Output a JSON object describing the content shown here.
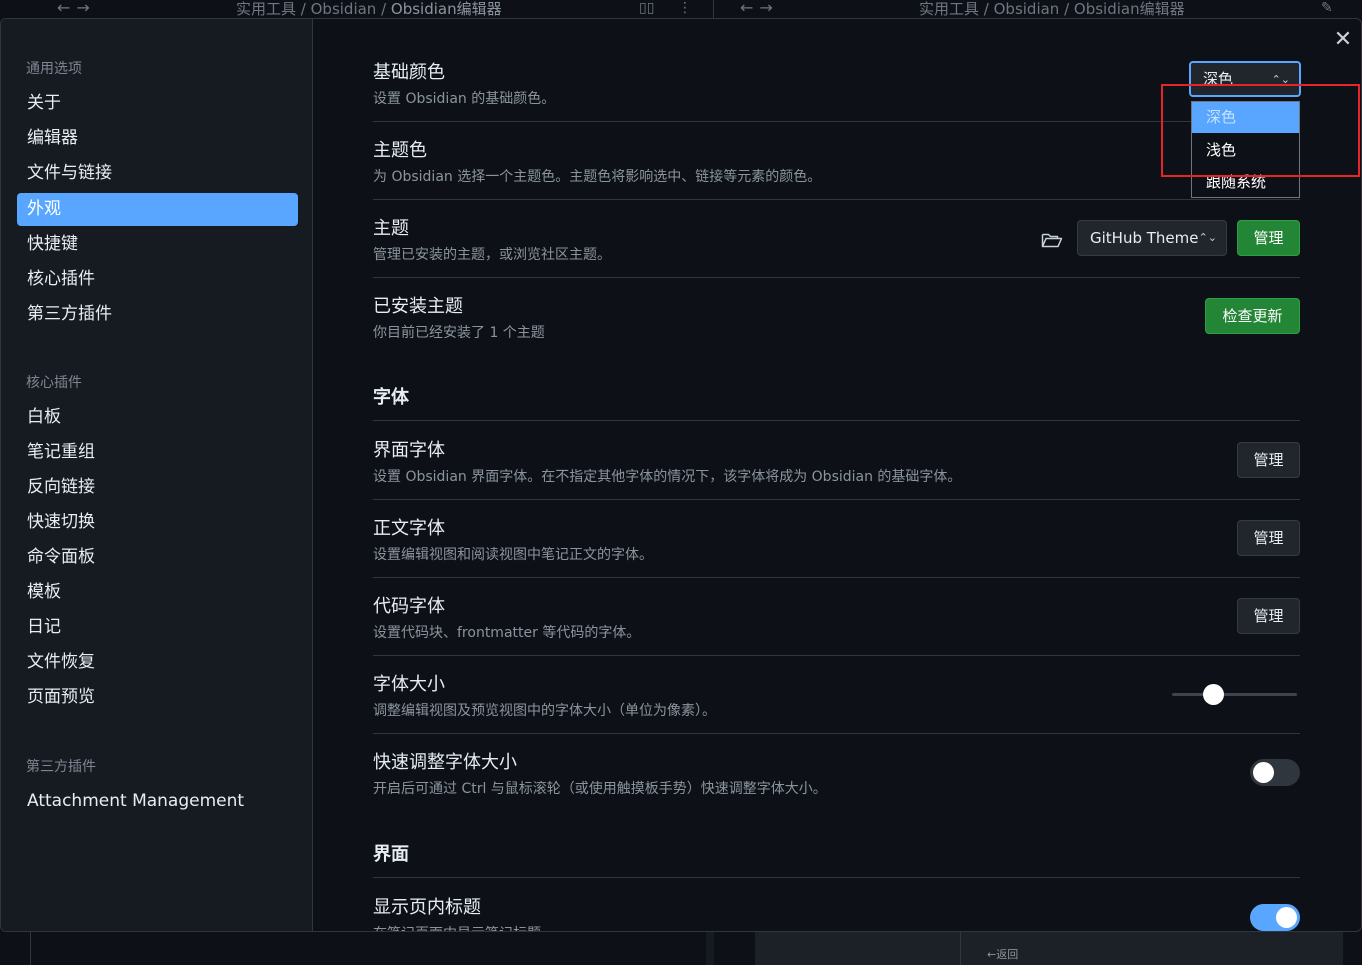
{
  "background": {
    "left_pane": {
      "breadcrumb_parts": [
        "实用工具",
        "Obsidian"
      ],
      "current": "Obsidian编辑器"
    },
    "right_pane": {
      "breadcrumb_parts": [
        "实用工具",
        "Obsidian"
      ],
      "current": "Obsidian编辑器"
    },
    "separator": " / ",
    "back_label": "返回"
  },
  "sidebar": {
    "groups": [
      {
        "title": "通用选项",
        "items": [
          "关于",
          "编辑器",
          "文件与链接",
          "外观",
          "快捷键",
          "核心插件",
          "第三方插件"
        ]
      },
      {
        "title": "核心插件",
        "items": [
          "白板",
          "笔记重组",
          "反向链接",
          "快速切换",
          "命令面板",
          "模板",
          "日记",
          "文件恢复",
          "页面预览"
        ]
      },
      {
        "title": "第三方插件",
        "items": [
          "Attachment Management"
        ]
      }
    ],
    "active_item": "外观"
  },
  "settings": {
    "base_color": {
      "name": "基础颜色",
      "desc": "设置 Obsidian 的基础颜色。",
      "value": "深色",
      "options": [
        "深色",
        "浅色",
        "跟随系统"
      ]
    },
    "accent_color": {
      "name": "主题色",
      "desc": "为 Obsidian 选择一个主题色。主题色将影响选中、链接等元素的颜色。"
    },
    "theme": {
      "name": "主题",
      "desc": "管理已安装的主题，或浏览社区主题。",
      "value": "GitHub Theme",
      "button": "管理"
    },
    "installed_themes": {
      "name": "已安装主题",
      "desc": "你目前已经安装了 1 个主题",
      "button": "检查更新"
    },
    "font_heading": "字体",
    "interface_font": {
      "name": "界面字体",
      "desc": "设置 Obsidian 界面字体。在不指定其他字体的情况下，该字体将成为 Obsidian 的基础字体。",
      "button": "管理"
    },
    "text_font": {
      "name": "正文字体",
      "desc": "设置编辑视图和阅读视图中笔记正文的字体。",
      "button": "管理"
    },
    "code_font": {
      "name": "代码字体",
      "desc": "设置代码块、frontmatter 等代码的字体。",
      "button": "管理"
    },
    "font_size": {
      "name": "字体大小",
      "desc": "调整编辑视图及预览视图中的字体大小（单位为像素）。",
      "slider_fraction": 0.33
    },
    "quick_font_adjust": {
      "name": "快速调整字体大小",
      "desc": "开启后可通过 Ctrl 与鼠标滚轮（或使用触摸板手势）快速调整字体大小。",
      "enabled": false
    },
    "interface_heading": "界面",
    "show_inline_title": {
      "name": "显示页内标题",
      "desc": "在笔记页面内显示笔记标题",
      "enabled": true
    }
  },
  "colors": {
    "accent": "#58a6ff",
    "green_button": "#238636",
    "annotation_box": "#e5252a"
  }
}
